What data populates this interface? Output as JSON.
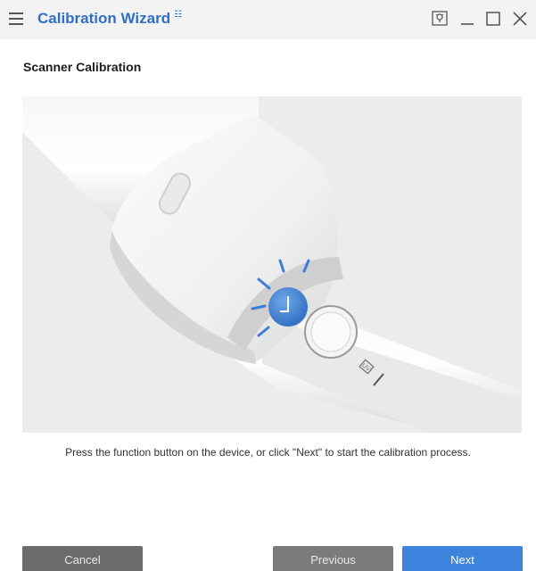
{
  "window": {
    "title": "Calibration Wizard",
    "title_badge": "☷",
    "controls": [
      "help",
      "minimize",
      "maximize",
      "close"
    ]
  },
  "page": {
    "heading": "Scanner Calibration",
    "instruction": "Press the function button on the device, or click \"Next\" to start the calibration process."
  },
  "illustration": {
    "subject": "scanner device with glowing function button",
    "button_glow_color": "#3a7fd6",
    "device_label": "UV"
  },
  "footer": {
    "cancel_label": "Cancel",
    "previous_label": "Previous",
    "next_label": "Next"
  },
  "colors": {
    "accent": "#3b83dd",
    "title_color": "#2f6fc7",
    "secondary_button": "#7b7b7b"
  }
}
